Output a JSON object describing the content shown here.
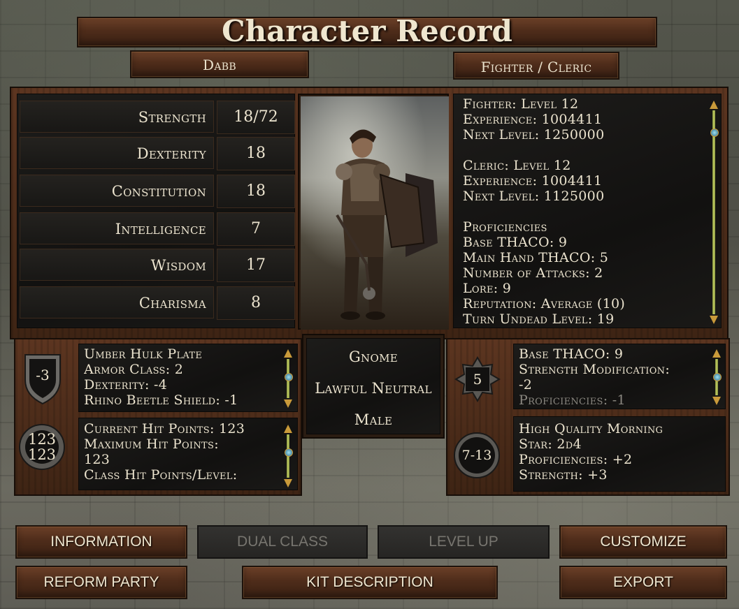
{
  "window": {
    "title": "Character Record"
  },
  "character": {
    "name": "Dabb",
    "class": "Fighter / Cleric"
  },
  "stats": [
    {
      "label": "Strength",
      "value": "18/72"
    },
    {
      "label": "Dexterity",
      "value": "18"
    },
    {
      "label": "Constitution",
      "value": "18"
    },
    {
      "label": "Intelligence",
      "value": "7"
    },
    {
      "label": "Wisdom",
      "value": "17"
    },
    {
      "label": "Charisma",
      "value": "8"
    }
  ],
  "info_lines": [
    "Fighter: Level 12",
    "Experience: 1004411",
    "Next Level: 1250000",
    "",
    "Cleric: Level 12",
    "Experience: 1004411",
    "Next Level: 1125000",
    "",
    "Proficiencies",
    "Base THACO: 9",
    "Main Hand THACO: 5",
    "Number of Attacks: 2",
    "Lore: 9",
    "Reputation: Average (10)",
    "Turn Undead Level: 19"
  ],
  "armor": {
    "badge": "-3",
    "lines": [
      "Umber Hulk Plate",
      "Armor Class: 2",
      "Dexterity: -4",
      "Rhino Beetle Shield: -1"
    ]
  },
  "hitpoints": {
    "current": "123",
    "maximum": "123",
    "lines": [
      "Current Hit Points: 123",
      "Maximum Hit Points:",
      "123",
      "Class Hit Points/Level:"
    ]
  },
  "identity": {
    "race": "Gnome",
    "alignment": "Lawful Neutral",
    "gender": "Male"
  },
  "thaco": {
    "badge": "5",
    "lines": [
      "Base THACO: 9",
      "Strength Modification:",
      "-2",
      "Proficiencies: -1"
    ]
  },
  "weapon": {
    "badge": "7-13",
    "lines": [
      "High Quality Morning",
      "Star: 2d4",
      "Proficiencies: +2",
      "Strength: +3"
    ]
  },
  "buttons": {
    "information": "INFORMATION",
    "dual_class": "DUAL CLASS",
    "level_up": "LEVEL UP",
    "customize": "CUSTOMIZE",
    "reform_party": "REFORM PARTY",
    "kit_description": "KIT DESCRIPTION",
    "export": "EXPORT"
  },
  "colors": {
    "scroll_accent": "#c6cf63",
    "wood": "#4e2c1a",
    "text": "#ece4cf",
    "disabled_text": "#77756f"
  }
}
